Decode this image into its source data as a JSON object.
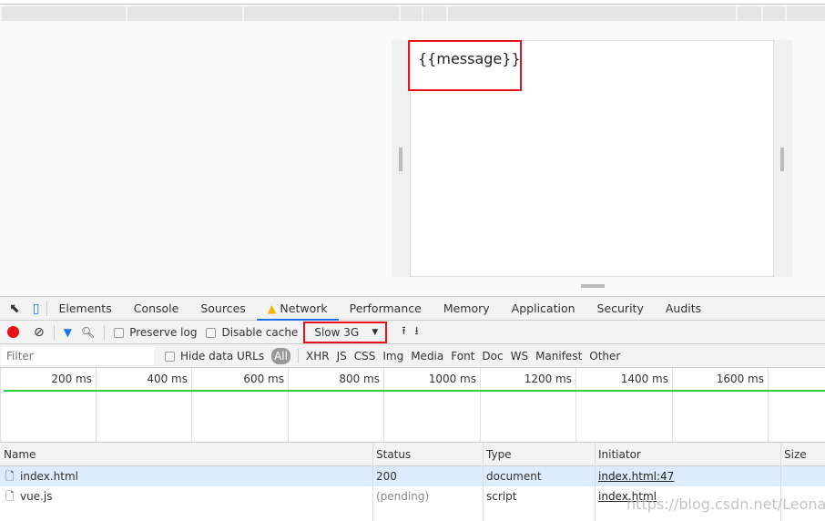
{
  "viewport": {
    "message": "{{message}}"
  },
  "devtools": {
    "tabs": [
      "Elements",
      "Console",
      "Sources",
      "Network",
      "Performance",
      "Memory",
      "Application",
      "Security",
      "Audits"
    ],
    "active_tab": "Network",
    "toolbar": {
      "preserve_log": "Preserve log",
      "disable_cache": "Disable cache",
      "throttling": "Slow 3G"
    },
    "filter": {
      "placeholder": "Filter",
      "hide_data_urls": "Hide data URLs",
      "types": [
        "All",
        "XHR",
        "JS",
        "CSS",
        "Img",
        "Media",
        "Font",
        "Doc",
        "WS",
        "Manifest",
        "Other"
      ]
    },
    "timeline_ticks": [
      "200 ms",
      "400 ms",
      "600 ms",
      "800 ms",
      "1000 ms",
      "1200 ms",
      "1400 ms",
      "1600 ms"
    ],
    "columns": [
      "Name",
      "Status",
      "Type",
      "Initiator",
      "Size"
    ],
    "rows": [
      {
        "name": "index.html",
        "status": "200",
        "type": "document",
        "initiator": "index.html:47",
        "size": ""
      },
      {
        "name": "vue.js",
        "status": "(pending)",
        "type": "script",
        "initiator": "index.html",
        "size": ""
      }
    ],
    "watermark": "https://blog.csdn.net/Leonardy",
    "colors": {
      "accent": "#1a73e8",
      "record": "#e8131a",
      "highlight": "#e8131a",
      "timeline": "#2ecc40",
      "selected_row": "#dcecfb"
    }
  }
}
